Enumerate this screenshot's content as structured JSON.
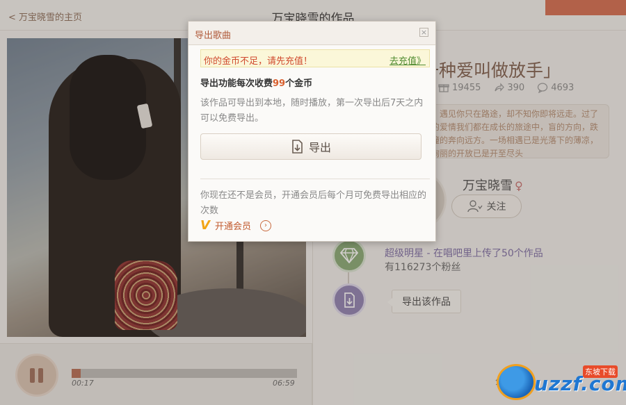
{
  "header": {
    "back_link": "< 万宝晓雪的主页",
    "title": "万宝晓雪的作品"
  },
  "player": {
    "current_time": "00:17",
    "total_time": "06:59",
    "progress_fraction": 0.04
  },
  "song": {
    "title": "一种爱叫做放手」",
    "stats": {
      "gifts": "19455",
      "shares": "390",
      "comments": "4693"
    },
    "description": "青春，遇见你只在路途，却不知你即将远走。过了年少的爱情我们都在成长的旅途中，盲的方向，跌跌撞撞的奔向远方。一场相遇已是光落下的薄凉，一场绚丽的开放已是开至尽头"
  },
  "artist": {
    "name": "万宝晓雪",
    "gender_symbol": "♀",
    "follow_label": "关注",
    "level_text": "超级明星 - 在唱吧里上传了50个作品",
    "fans_text": "有116273个粉丝"
  },
  "side_button": {
    "export_work_label": "导出该作品"
  },
  "share_fragment": "分",
  "watermark": {
    "brand": "uzzf.com",
    "tag": "东坡下载"
  },
  "dialog": {
    "title": "导出歌曲",
    "close_symbol": "×",
    "alert_text": "你的金币不足，请先充值！",
    "recharge_link": "去充值》",
    "price_prefix": "导出功能每次收费",
    "price_num": "99",
    "price_suffix": "个金币",
    "description": "该作品可导出到本地，随时播放，第一次导出后7天之内可以免费导出。",
    "export_button": "导出",
    "member_text": "你现在还不是会员，开通会员后每个月可免费导出相应的次数",
    "vip_icon": "V",
    "vip_link": "开通会员",
    "vip_arrow": "›"
  },
  "colors": {
    "accent": "#b05b3b",
    "alert": "#d04a2e",
    "link_green": "#4f8b2f",
    "price_orange": "#d8602f"
  }
}
